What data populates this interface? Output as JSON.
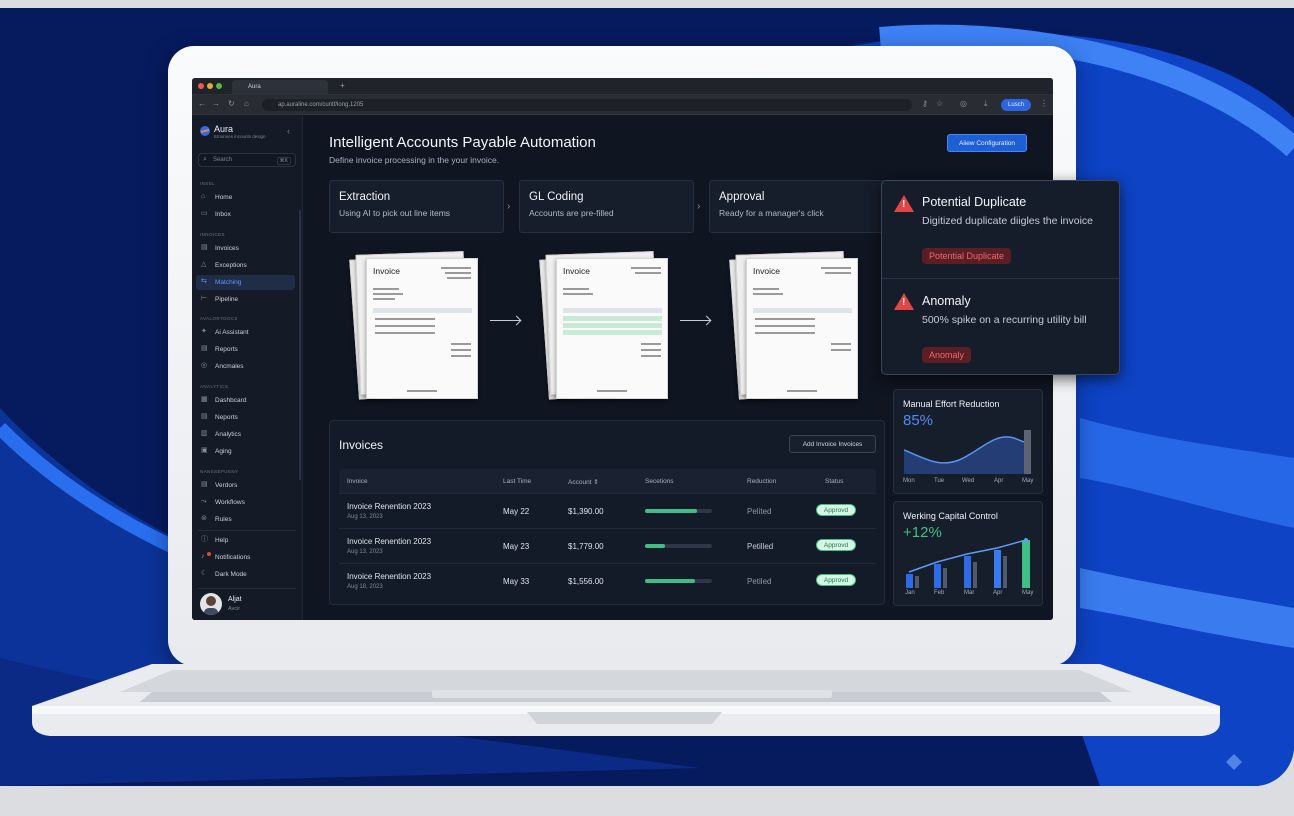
{
  "browser": {
    "tab_title": "Aura",
    "new_tab": "+",
    "url": "ap.auraline.com/cuntf/long.1205",
    "profile": "Lusch"
  },
  "sidebar": {
    "brand": "Aura",
    "brand_sub": "Emonoes incounts design",
    "collapse": "‹",
    "search_placeholder": "Search",
    "search_shortcut": "⌘K",
    "sections": [
      {
        "label": "INSEL",
        "items": [
          {
            "label": "Home",
            "icon": "home-icon"
          },
          {
            "label": "Inbox",
            "icon": "inbox-icon"
          }
        ]
      },
      {
        "label": "INNOICES",
        "items": [
          {
            "label": "Invoices",
            "icon": "document-icon"
          },
          {
            "label": "Exceptions",
            "icon": "warning-icon"
          },
          {
            "label": "Matching",
            "icon": "link-icon"
          },
          {
            "label": "Pipeline",
            "icon": "pipeline-icon"
          }
        ]
      },
      {
        "label": "AVALORTOOCS",
        "items": [
          {
            "label": "Ai Assistant",
            "icon": "sparkle-icon"
          },
          {
            "label": "Reports",
            "icon": "report-icon"
          },
          {
            "label": "Ancmales",
            "icon": "anomaly-icon"
          }
        ]
      },
      {
        "label": "ANALYTICS",
        "items": [
          {
            "label": "Dashbcard",
            "icon": "dashboard-icon"
          },
          {
            "label": "Neports",
            "icon": "report-icon"
          },
          {
            "label": "Analytics",
            "icon": "bar-chart-icon"
          },
          {
            "label": "Aging",
            "icon": "calendar-icon"
          }
        ]
      },
      {
        "label": "NANSSEPUENY",
        "items": [
          {
            "label": "Verdors",
            "icon": "vendor-icon"
          },
          {
            "label": "Workflows",
            "icon": "workflow-icon"
          },
          {
            "label": "Rules",
            "icon": "rules-icon"
          }
        ]
      }
    ],
    "footer_items": [
      {
        "label": "Help",
        "icon": "help-icon"
      },
      {
        "label": "Notifications",
        "icon": "bell-icon"
      },
      {
        "label": "Dark Mode",
        "icon": "moon-icon"
      }
    ],
    "user": {
      "name": "Aljat",
      "role": "Avcir"
    }
  },
  "header": {
    "title": "Intelligent Accounts Payable Automation",
    "subtitle": "Define invoice processing in the your invoice.",
    "config_button": "Aiiew Configuration"
  },
  "steps": [
    {
      "title": "Extraction",
      "desc": "Using AI to pick out line items"
    },
    {
      "title": "GL Coding",
      "desc": "Accounts are pre-filled"
    },
    {
      "title": "Approval",
      "desc": "Ready for a manager's click"
    }
  ],
  "invoice_doc_title": "Invoice",
  "invoices": {
    "title": "Invoices",
    "add_button": "Add Invoice Invoices",
    "columns": [
      "Invoice",
      "Last Time",
      "Account ⇕",
      "Secetions",
      "Reduction",
      "Status"
    ],
    "rows": [
      {
        "name": "Invoice Renention 2023",
        "date": "Aug 13, 2023",
        "last_time": "May 22",
        "amount": "$1,390.00",
        "progress": 0.78,
        "reduction": "Pelited",
        "status": "Approvd"
      },
      {
        "name": "Invoice Renention 2023",
        "date": "Aug 13, 2023",
        "last_time": "May 23",
        "amount": "$1,779.00",
        "progress": 0.3,
        "reduction": "Petilled",
        "status": "Approvd"
      },
      {
        "name": "Invoice Renention 2023",
        "date": "Aug 18, 2023",
        "last_time": "May 33",
        "amount": "$1,556.00",
        "progress": 0.74,
        "reduction": "Petiled",
        "status": "Approvd"
      }
    ]
  },
  "alerts": [
    {
      "title": "Potential Duplicate",
      "desc": "Digitized duplicate diigles the invoice",
      "badge": "Potential Duplicate",
      "icon": "warning-icon"
    },
    {
      "title": "Anomaly",
      "desc": "500% spike on a recurring utility bill",
      "badge": "Anomaly",
      "icon": "warning-icon"
    }
  ],
  "metrics": {
    "manual": {
      "title": "Manual Effort Reduction",
      "value": "85%",
      "color": "#4f8df5",
      "x": [
        "Mon",
        "Tue",
        "Wed",
        "Apr",
        "May"
      ]
    },
    "working": {
      "title": "Werking Capital Control",
      "value": "+12%",
      "color": "#3fbf86",
      "x": [
        "Jan",
        "Feb",
        "Mar",
        "Apr",
        "May"
      ]
    }
  },
  "colors": {
    "accent": "#1f5fd6",
    "success": "#3fbf86",
    "danger": "#e04646"
  }
}
